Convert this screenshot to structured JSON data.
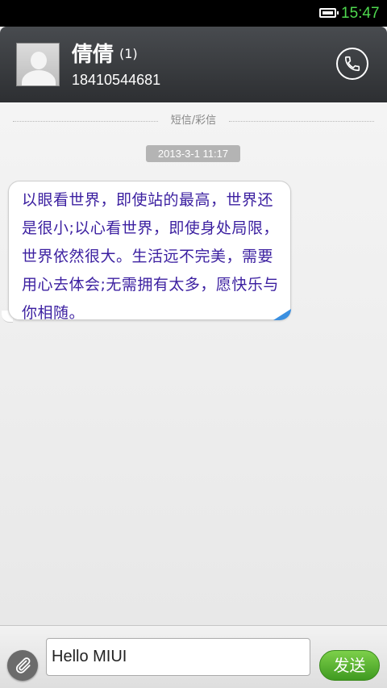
{
  "status_bar": {
    "time": "15:47",
    "battery_icon": "battery-icon"
  },
  "header": {
    "contact_name": "倩倩",
    "unread_count": "(1)",
    "phone_number": "18410544681",
    "avatar_icon": "default-avatar-icon",
    "call_icon": "phone-icon"
  },
  "conversation": {
    "divider_label": "短信/彩信",
    "timestamp": "2013-3-1 11:17",
    "messages": [
      {
        "text": "以眼看世界，即使站的最高，世界还是很小;以心看世界，即使身处局限，世界依然很大。生活远不完美，需要用心去体会;无需拥有太多，愿快乐与你相随。"
      }
    ]
  },
  "compose": {
    "input_value": "Hello MIUI",
    "send_label": "发送",
    "attach_icon": "paperclip-icon"
  },
  "colors": {
    "status_time": "#4fd94f",
    "header_bg": "#3a3c3f",
    "message_text": "#3b1fa0",
    "send_button": "#4ea82a",
    "bubble_corner": "#3a8fe0"
  }
}
